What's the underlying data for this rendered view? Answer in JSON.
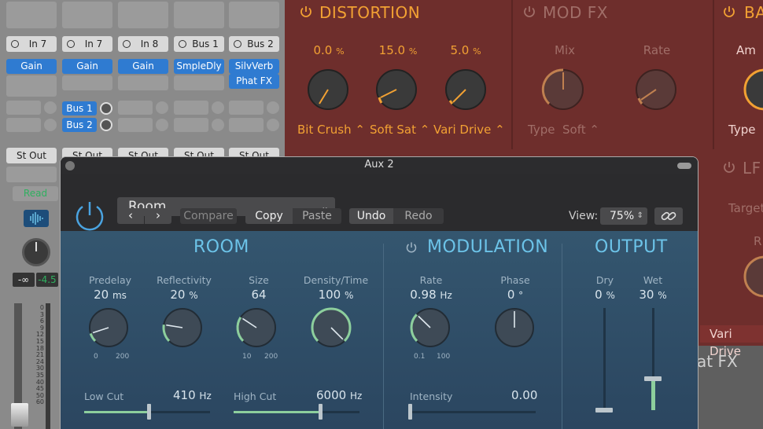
{
  "mixer": {
    "strips": [
      {
        "input": "In 7",
        "insert": "Gain",
        "output": "St Out"
      },
      {
        "input": "In 7",
        "insert": "Gain",
        "sends": [
          "Bus 1",
          "Bus 2"
        ],
        "output": "St Out"
      },
      {
        "input": "In 8",
        "insert": "Gain",
        "output": "St Out"
      },
      {
        "input": "Bus 1",
        "insert": "SmpleDly",
        "output": "St Out"
      },
      {
        "input": "Bus 2",
        "inserts": [
          "SilvVerb",
          "Phat FX"
        ],
        "output": "St Out"
      }
    ],
    "automation": "Read",
    "volume_left": "-∞",
    "volume_right": "-4.5",
    "scale": [
      "0",
      "3",
      "6",
      "9",
      "12",
      "15",
      "18",
      "21",
      "24",
      "30",
      "35",
      "40",
      "45",
      "50",
      "60"
    ]
  },
  "distortion": {
    "title": "DISTORTION",
    "knobs": [
      {
        "value": "0.0",
        "unit": "%",
        "selector": "Bit Crush"
      },
      {
        "value": "15.0",
        "unit": "%",
        "selector": "Soft Sat"
      },
      {
        "value": "5.0",
        "unit": "%",
        "selector": "Vari Drive"
      }
    ]
  },
  "modfx": {
    "title": "MOD FX",
    "labels": [
      "Mix",
      "Rate"
    ],
    "type_label": "Type",
    "type_value": "Soft"
  },
  "ba": {
    "title": "BA",
    "label": "Am",
    "type_label": "Type"
  },
  "lfo": {
    "title": "LF",
    "target": "Target",
    "r": "R"
  },
  "bottom": {
    "insert": "Vari Drive",
    "name": "at FX"
  },
  "plugin": {
    "window_title": "Aux 2",
    "preset": "Room",
    "buttons": {
      "compare": "Compare",
      "copy": "Copy",
      "paste": "Paste",
      "undo": "Undo",
      "redo": "Redo"
    },
    "view_label": "View:",
    "view_value": "75%",
    "room": {
      "title": "ROOM",
      "params": [
        {
          "label": "Predelay",
          "value": "20",
          "unit": "ms",
          "min": "0",
          "max": "200",
          "norm": 0.1
        },
        {
          "label": "Reflectivity",
          "value": "20",
          "unit": "%",
          "norm": 0.2
        },
        {
          "label": "Size",
          "value": "64",
          "unit": "",
          "min": "10",
          "max": "200",
          "norm": 0.29
        },
        {
          "label": "Density/Time",
          "value": "100",
          "unit": "%",
          "norm": 1.0
        }
      ],
      "low_cut": {
        "label": "Low Cut",
        "value": "410",
        "unit": "Hz"
      },
      "high_cut": {
        "label": "High Cut",
        "value": "6000",
        "unit": "Hz"
      }
    },
    "modulation": {
      "title": "MODULATION",
      "rate": {
        "label": "Rate",
        "value": "0.98",
        "unit": "Hz",
        "min": "0.1",
        "max": "100",
        "norm": 0.33
      },
      "phase": {
        "label": "Phase",
        "value": "0",
        "unit": "°",
        "norm": 0.5
      },
      "intensity": {
        "label": "Intensity",
        "value": "0.00"
      }
    },
    "output": {
      "title": "OUTPUT",
      "dry": {
        "label": "Dry",
        "value": "0",
        "unit": "%"
      },
      "wet": {
        "label": "Wet",
        "value": "30",
        "unit": "%"
      }
    }
  },
  "colors": {
    "accent_blue": "#6cc3e8",
    "fx_orange": "#f2a133",
    "green_fill": "#8dcf9d",
    "insert_blue": "#2f7bd1"
  }
}
